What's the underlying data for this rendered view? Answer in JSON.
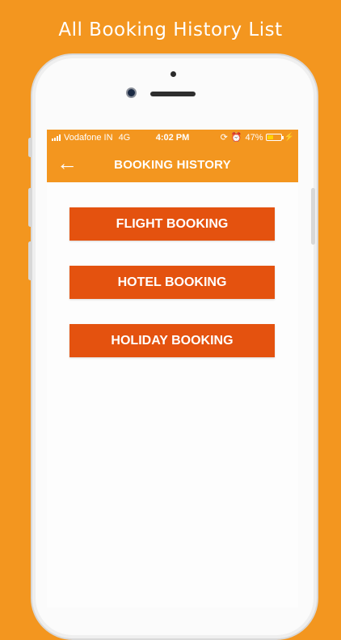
{
  "caption": "All Booking History List",
  "status_bar": {
    "carrier": "Vodafone IN",
    "network": "4G",
    "time": "4:02 PM",
    "battery": "47%",
    "battery_level": 0.47,
    "battery_color": "#FFD400"
  },
  "header": {
    "title": "BOOKING HISTORY",
    "back_icon": "arrow-left-icon"
  },
  "buttons": [
    {
      "label": "FLIGHT BOOKING"
    },
    {
      "label": "HOTEL BOOKING"
    },
    {
      "label": "HOLIDAY BOOKING"
    }
  ],
  "colors": {
    "brand_orange": "#F3961F",
    "button_orange": "#E4520F"
  }
}
